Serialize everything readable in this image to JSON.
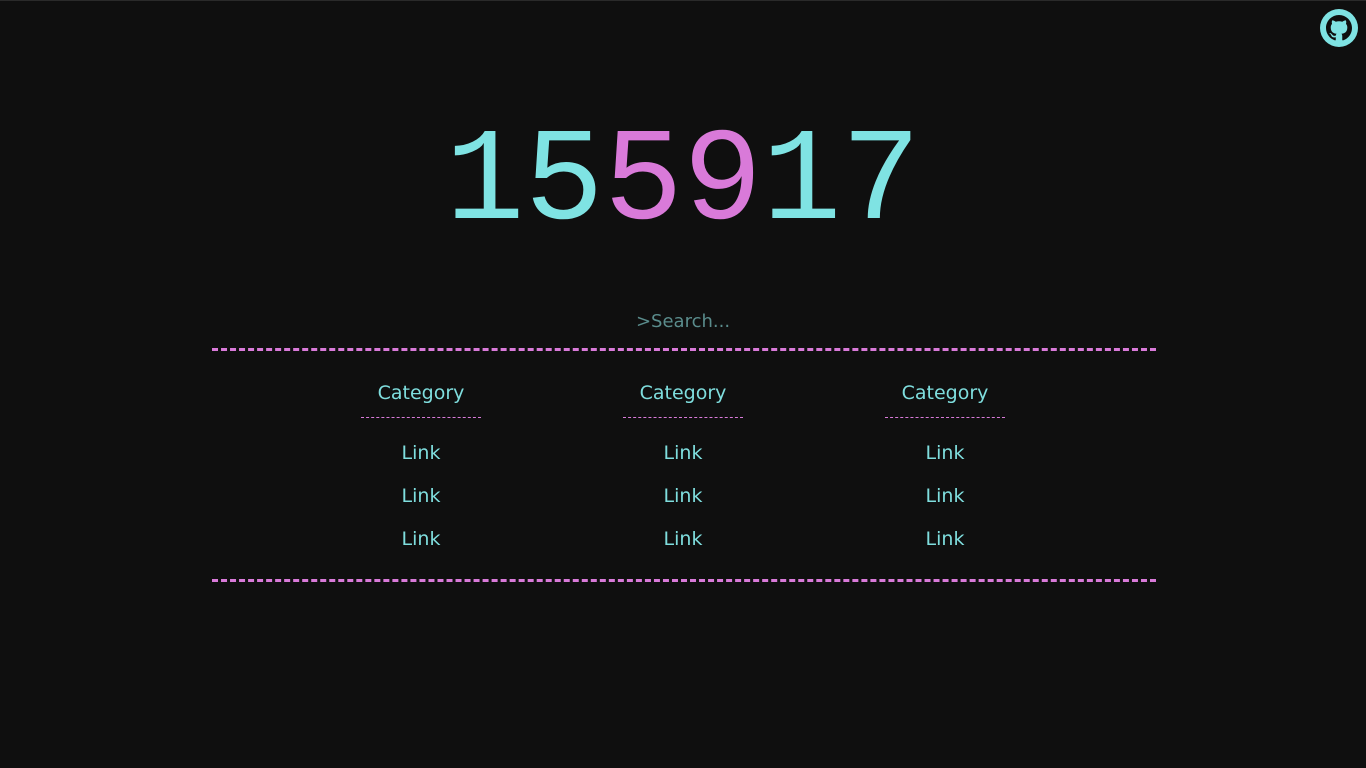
{
  "header": {
    "github_icon": "github-icon"
  },
  "clock": {
    "digits": [
      {
        "char": "1",
        "color": "#7fe3e3"
      },
      {
        "char": "5",
        "color": "#7fe3e3"
      },
      {
        "char": "5",
        "color": "#d97ad9"
      },
      {
        "char": "9",
        "color": "#d97ad9"
      },
      {
        "char": "1",
        "color": "#7fe3e3"
      },
      {
        "char": "7",
        "color": "#7fe3e3"
      }
    ]
  },
  "search": {
    "value": "",
    "placeholder": ">Search..."
  },
  "categories": [
    {
      "label": "Category",
      "links": [
        "Link",
        "Link",
        "Link"
      ]
    },
    {
      "label": "Category",
      "links": [
        "Link",
        "Link",
        "Link"
      ]
    },
    {
      "label": "Category",
      "links": [
        "Link",
        "Link",
        "Link"
      ]
    }
  ],
  "colors": {
    "background": "#0f0f0f",
    "cyan": "#7fe3e3",
    "magenta": "#d97ad9"
  }
}
